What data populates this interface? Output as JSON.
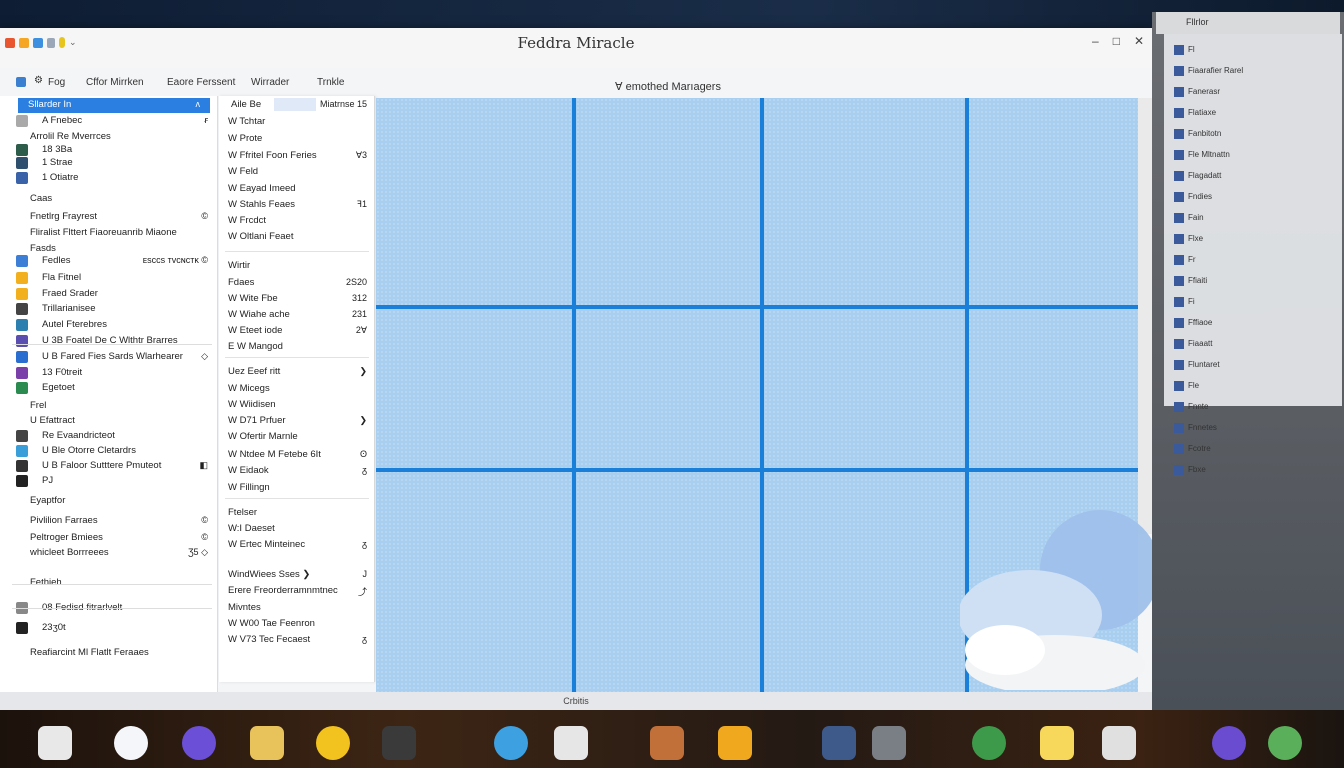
{
  "window": {
    "title": "Feddra Miracle",
    "controls": [
      "–",
      "□",
      "✕"
    ]
  },
  "menubar": {
    "items": [
      "Fog",
      "Cffor Mirrken",
      "Eaore Ferssent",
      "Wirrader",
      "Trnkle"
    ],
    "center_label": "Ɐ emothed Marıagers"
  },
  "sidebar": {
    "selected": "Sllarder In",
    "rows": [
      {
        "label": "Sllarder In",
        "right": "ʌ",
        "selected": true,
        "icon_color": ""
      },
      {
        "label": "A Fnebec",
        "right": "ꞧ",
        "icon_color": "#a9a9a9"
      },
      {
        "label": "Arrolil Re Mverrces",
        "right": "",
        "icon_color": ""
      },
      {
        "label": "18 3Ba",
        "right": "",
        "icon_color": "#2e5c4a"
      },
      {
        "label": "1 Strae",
        "right": "",
        "icon_color": "#2f4f6e"
      },
      {
        "label": "1 Otiatre",
        "right": "",
        "icon_color": "#3a62a8"
      },
      {
        "label": "Caas",
        "right": "",
        "icon_color": ""
      },
      {
        "label": "Fnetlrg Frayrest",
        "right": "©",
        "icon_color": ""
      },
      {
        "label": "Fliralist Flttert Fiaoreuanrib Miaone",
        "right": "",
        "icon_color": ""
      },
      {
        "label": "Fasds",
        "right": "",
        "icon_color": ""
      },
      {
        "label": "Fedles",
        "right": "ᴇsᴄᴄs ᴛᴠᴄɴᴄᴛᴋ ©",
        "icon_color": "#3d7fd6"
      },
      {
        "label": "Fla Fitnel",
        "right": "",
        "icon_color": "#f2b01e"
      },
      {
        "label": "Fraed Srader",
        "right": "",
        "icon_color": "#f2b01e"
      },
      {
        "label": "Trillarianisee",
        "right": "",
        "icon_color": "#444"
      },
      {
        "label": "Autel Fterebres",
        "right": "",
        "icon_color": "#2d7fb0"
      },
      {
        "label": "U 3B Foatel De C Wlthtr Brarres",
        "right": "",
        "icon_color": "#5a4fb0"
      },
      {
        "label": "U B Fared Fies Sards Wlarhearer",
        "right": "◇",
        "icon_color": "#2a6fd0"
      },
      {
        "label": "13 F0treit",
        "right": "",
        "icon_color": "#7a3fa8"
      },
      {
        "label": "Egetoet",
        "right": "",
        "icon_color": "#2a8a50"
      },
      {
        "label": "Frel",
        "right": "",
        "icon_color": ""
      },
      {
        "label": "U Efattract",
        "right": "",
        "icon_color": ""
      },
      {
        "label": "Re Evaandricteot",
        "right": "",
        "icon_color": "#444"
      },
      {
        "label": "U Ble Otorre Cletardrs",
        "right": "",
        "icon_color": "#3a9ed8"
      },
      {
        "label": "U B Faloor Sutttere Pmuteot",
        "right": "◧",
        "icon_color": "#333"
      },
      {
        "label": "PJ",
        "right": "",
        "icon_color": "#222"
      },
      {
        "label": "Eyaptfor",
        "right": "",
        "icon_color": ""
      },
      {
        "label": "Pivlilion Farraes",
        "right": "©",
        "icon_color": ""
      },
      {
        "label": "Peltroger Bmiees",
        "right": "©",
        "icon_color": ""
      },
      {
        "label": "whicleet Borrreees",
        "right": "Ʒ5 ◇",
        "icon_color": ""
      },
      {
        "label": "Fethieh",
        "right": "",
        "icon_color": ""
      },
      {
        "label": "08 Fedisd fitrarlvelt",
        "right": "",
        "icon_color": "#888"
      },
      {
        "label": "23ʒ0t",
        "right": "",
        "icon_color": "#222"
      },
      {
        "label": "Reafiarcint Ml Flatlt Feraaes",
        "right": "",
        "icon_color": ""
      }
    ]
  },
  "menu_panel": {
    "header": {
      "left": "Aile Be",
      "right": "Miatrnse 15"
    },
    "rows": [
      {
        "label": "W Tchtar",
        "right": ""
      },
      {
        "label": "W Prote",
        "right": ""
      },
      {
        "label": "W Ffritel Foon Feries",
        "right": "Ɐ3"
      },
      {
        "label": "W Feld",
        "right": ""
      },
      {
        "label": "W Eayad Imeed",
        "right": ""
      },
      {
        "label": "W Stahls Feaes",
        "right": "ꟻ1"
      },
      {
        "label": "W Frcdct",
        "right": ""
      },
      {
        "label": "W Oltlani Feaet",
        "right": ""
      },
      {
        "label": "Wirtir",
        "right": ""
      },
      {
        "label": "Fdaes",
        "right": "2S20"
      },
      {
        "label": "W Wite Fbe",
        "right": "312"
      },
      {
        "label": "W Wiahe ache",
        "right": "231"
      },
      {
        "label": "W Eteet iode",
        "right": "2Ɐ"
      },
      {
        "label": "E W Mangod",
        "right": ""
      },
      {
        "label": "Uez Eeef ritt",
        "right": "❯"
      },
      {
        "label": "W Micegs",
        "right": ""
      },
      {
        "label": "W Wiidisen",
        "right": ""
      },
      {
        "label": "W D71 Prfuer",
        "right": "❯"
      },
      {
        "label": "W Ofertir Marnle",
        "right": ""
      },
      {
        "label": "W Ntdee M Fetebe 6It",
        "right": "ʘ"
      },
      {
        "label": "W Eidaok",
        "right": "ᵹ"
      },
      {
        "label": "W Fillingn",
        "right": ""
      },
      {
        "label": "Ftelser",
        "right": ""
      },
      {
        "label": "W:I Daeset",
        "right": ""
      },
      {
        "label": "W Ertec Minteinec",
        "right": "ᵹ"
      },
      {
        "label": "WindWiees    Sses  ❯",
        "right": "J"
      },
      {
        "label": "Erere Freorderramnmtnec",
        "right": "⤴"
      },
      {
        "label": "Mivntes",
        "right": ""
      },
      {
        "label": "W W00 Tae Feenron",
        "right": ""
      },
      {
        "label": "W V73 Tec Fecaest",
        "right": "ᵹ"
      }
    ]
  },
  "statusbar": {
    "text": "Crbitis"
  },
  "right_panel": {
    "title": "Fllrlor",
    "items": [
      "Fl",
      "Fiaarafier Rarel",
      "Fanerasr",
      "Flatiaxe",
      "Fanbitotn",
      "Fle Mltnattn",
      "Flagadatt",
      "Fndies",
      "Fain",
      "Flxe",
      "Fr",
      "Ffiaiti",
      "Fi",
      "Fffiaoe",
      "Fiaaatt",
      "Fluntaret",
      "Fle",
      "Fnnte",
      "Fnnetes",
      "Fcotre",
      "Fbxe"
    ]
  },
  "dock": {
    "icons": [
      {
        "name": "documents-icon",
        "color": "#e8e8e8"
      },
      {
        "name": "finder-icon",
        "color": "#f4f6fa"
      },
      {
        "name": "shortcuts-icon",
        "color": "#6b4fd6"
      },
      {
        "name": "preview-icon",
        "color": "#e8c25a"
      },
      {
        "name": "safari-icon",
        "color": "#f2c21e"
      },
      {
        "name": "script-icon",
        "color": "#3a3a3a"
      },
      {
        "name": "bird-app-icon",
        "color": "#3da0e0"
      },
      {
        "name": "files-icon",
        "color": "#e6e6e6"
      },
      {
        "name": "flags-icon",
        "color": "#c2703a"
      },
      {
        "name": "folder-icon",
        "color": "#f0a81e"
      },
      {
        "name": "terminal-icon",
        "color": "#3d5a8a"
      },
      {
        "name": "camera-icon",
        "color": "#7a7f86"
      },
      {
        "name": "chrome-icon",
        "color": "#3c9a4a"
      },
      {
        "name": "notes-icon",
        "color": "#f7d85a"
      },
      {
        "name": "mail-icon",
        "color": "#e0e0e0"
      },
      {
        "name": "appstore-icon",
        "color": "#6a4cd0"
      },
      {
        "name": "music-icon",
        "color": "#5ab05a"
      }
    ]
  },
  "colors": {
    "grid_line": "#1a7fd8",
    "canvas": "#a9cff0",
    "selection": "#2b7fe0"
  }
}
